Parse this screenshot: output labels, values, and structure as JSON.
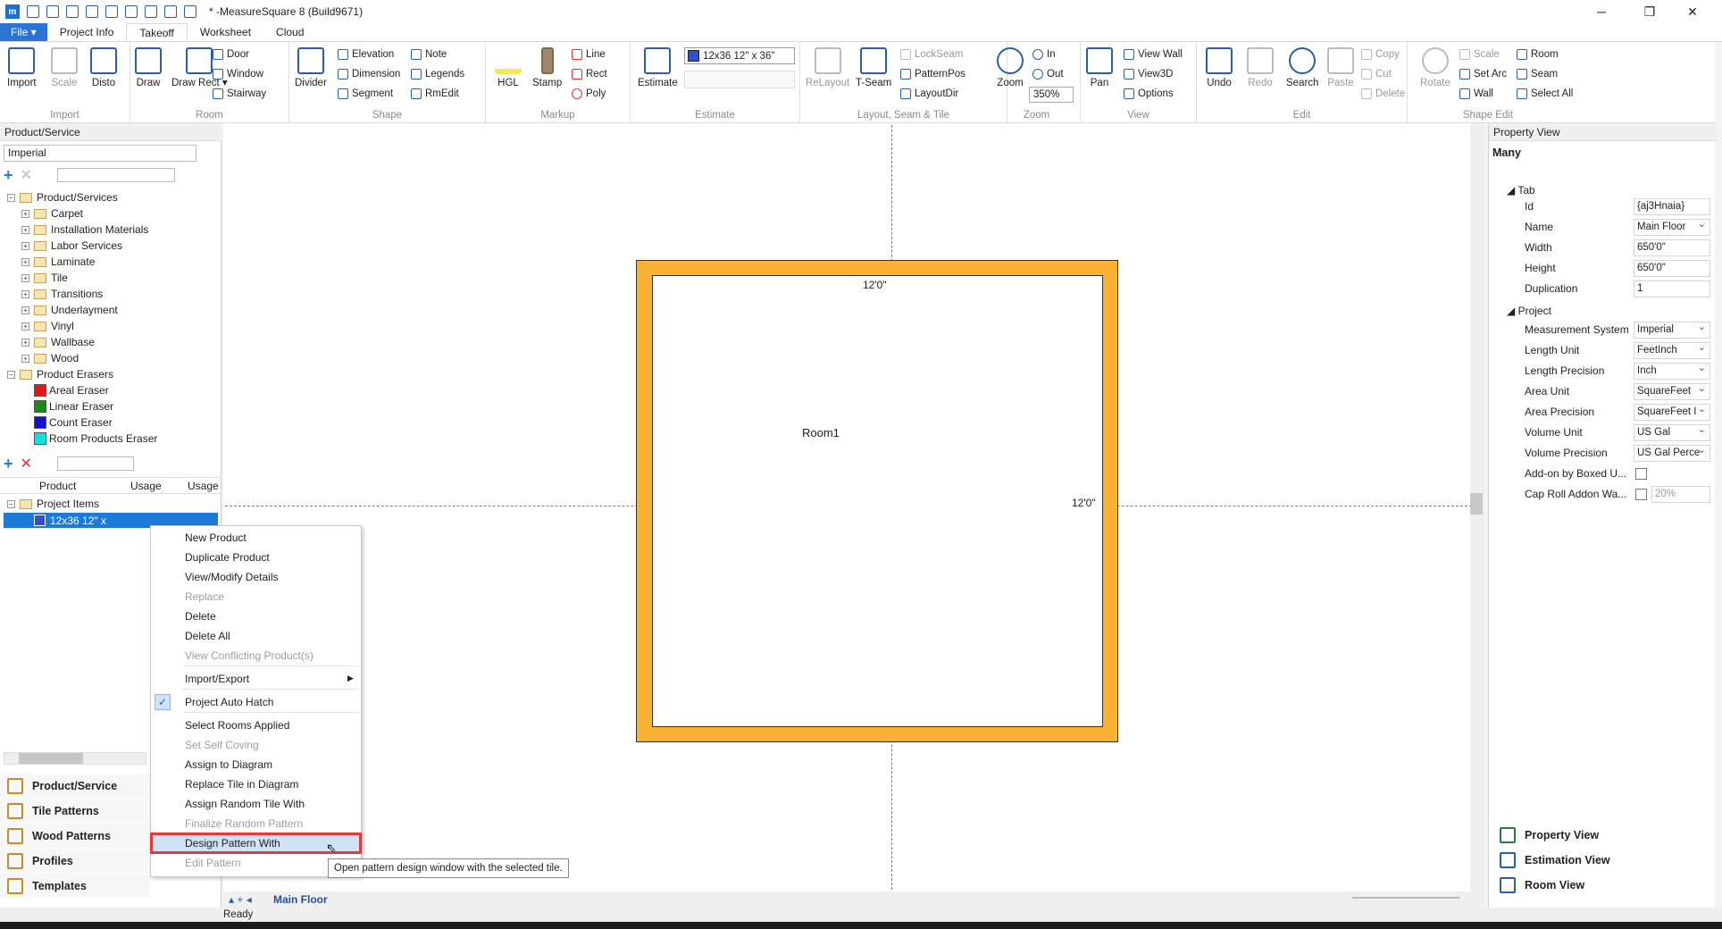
{
  "window": {
    "title": "* -MeasureSquare 8 (Build9671)",
    "minimize": "─",
    "maximize": "❐",
    "close": "✕"
  },
  "tabs": [
    "File ▾",
    "Project Info",
    "Takeoff",
    "Worksheet",
    "Cloud"
  ],
  "ribbon": {
    "import_group": {
      "label": "Import",
      "import": "Import",
      "scale": "Scale",
      "disto": "Disto"
    },
    "room_group": {
      "label": "Room",
      "draw": "Draw",
      "draw_rect": "Draw Rect ▾",
      "door": "Door",
      "window": "Window",
      "stairway": "Stairway"
    },
    "shape_group": {
      "label": "Shape",
      "divider": "Divider",
      "elevation": "Elevation",
      "dimension": "Dimension",
      "segment": "Segment",
      "note": "Note",
      "legends": "Legends",
      "rmedit": "RmEdit"
    },
    "markup_group": {
      "label": "Markup",
      "hgl": "HGL",
      "stamp": "Stamp",
      "line": "Line",
      "rect": "Rect",
      "poly": "Poly"
    },
    "estimate_group": {
      "label": "Estimate",
      "estimate": "Estimate",
      "product_select": "12x36 12\" x 36\""
    },
    "layout_group": {
      "label": "Layout, Seam & Tile",
      "relayout": "ReLayout",
      "tseam": "T-Seam",
      "lockseam": "LockSeam",
      "patternpos": "PatternPos",
      "layoutdir": "LayoutDir"
    },
    "zoom_group": {
      "label": "Zoom",
      "zoom": "Zoom",
      "in": "In",
      "out": "Out",
      "zoom_value": "350%"
    },
    "view_group": {
      "label": "View",
      "pan": "Pan",
      "view_wall": "View Wall",
      "view3d": "View3D",
      "options": "Options"
    },
    "edit_group": {
      "label": "Edit",
      "undo": "Undo",
      "redo": "Redo",
      "search": "Search",
      "paste": "Paste",
      "copy": "Copy",
      "cut": "Cut",
      "delete": "Delete"
    },
    "shape_edit_group": {
      "label": "Shape Edit",
      "rotate": "Rotate",
      "scale": "Scale",
      "set_arc": "Set Arc",
      "wall": "Wall",
      "room": "Room",
      "seam": "Seam",
      "select_all": "Select All"
    }
  },
  "left_panel": {
    "title": "Product/Service",
    "unit_select": "Imperial",
    "tree_root": "Product/Services",
    "tree_items": [
      "Carpet",
      "Installation Materials",
      "Labor Services",
      "Laminate",
      "Tile",
      "Transitions",
      "Underlayment",
      "Vinyl",
      "Wallbase",
      "Wood"
    ],
    "erasers_root": "Product Erasers",
    "erasers": [
      {
        "label": "Areal Eraser",
        "color": "#e81818"
      },
      {
        "label": "Linear Eraser",
        "color": "#1a8a1a"
      },
      {
        "label": "Count Eraser",
        "color": "#1010d8"
      },
      {
        "label": "Room Products Eraser",
        "color": "#10e0e0"
      }
    ],
    "grid_headers": [
      "Product",
      "Usage",
      "Usage"
    ],
    "project_items": "Project Items",
    "selected_item": "12x36 12\" x",
    "nav": [
      "Product/Service",
      "Tile Patterns",
      "Wood Patterns",
      "Profiles",
      "Templates"
    ]
  },
  "canvas": {
    "room_label": "Room1",
    "dim_top": "12'0\"",
    "dim_right": "12'0\"",
    "floor_tab": "Main Floor"
  },
  "context_menu": {
    "items": [
      "New Product",
      "Duplicate Product",
      "View/Modify Details",
      "Replace",
      "Delete",
      "Delete All",
      "View Conflicting Product(s)",
      "Import/Export",
      "Project Auto Hatch",
      "Select Rooms Applied",
      "Set Self Coving",
      "Assign to Diagram",
      "Replace Tile in Diagram",
      "Assign Random Tile With",
      "Finalize Random Pattern",
      "Design Pattern With",
      "Edit Pattern"
    ],
    "tooltip": "Open pattern design window with the selected tile."
  },
  "property_view": {
    "title": "Property View",
    "header": "Many",
    "section_tab": "Tab",
    "section_project": "Project",
    "rows": [
      {
        "key": "Id",
        "value": "{aj3Hnaia}"
      },
      {
        "key": "Name",
        "value": "Main Floor"
      },
      {
        "key": "Width",
        "value": "650'0\""
      },
      {
        "key": "Height",
        "value": "650'0\""
      },
      {
        "key": "Duplication",
        "value": "1"
      },
      {
        "key": "Measurement System",
        "value": "Imperial"
      },
      {
        "key": "Length Unit",
        "value": "FeetInch"
      },
      {
        "key": "Length Precision",
        "value": "Inch"
      },
      {
        "key": "Area Unit",
        "value": "SquareFeet"
      },
      {
        "key": "Area Precision",
        "value": "SquareFeet I"
      },
      {
        "key": "Volume Unit",
        "value": "US Gal"
      },
      {
        "key": "Volume Precision",
        "value": "US Gal Perce"
      },
      {
        "key": "Add-on by Boxed U...",
        "value": ""
      },
      {
        "key": "Cap Roll Addon Wa...",
        "value": "20%"
      }
    ],
    "nav": [
      "Property View",
      "Estimation View",
      "Room View"
    ]
  },
  "status": "Ready"
}
